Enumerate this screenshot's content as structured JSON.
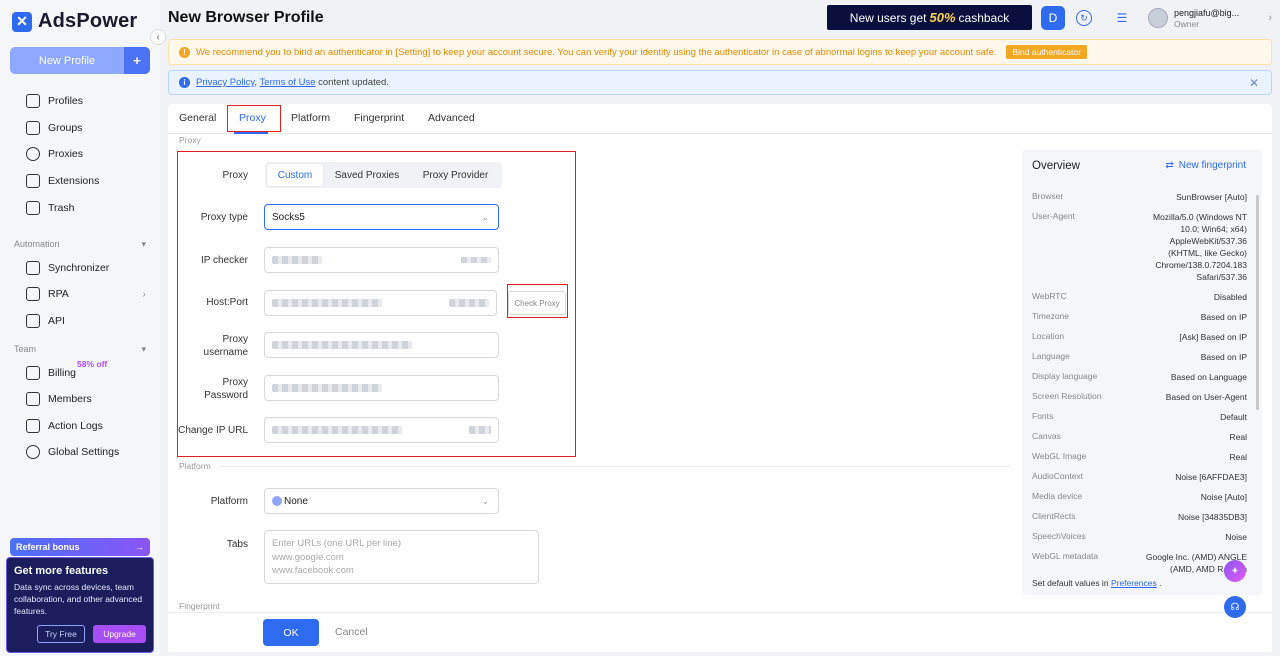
{
  "app": {
    "name": "AdsPower",
    "logo_glyph": "✕"
  },
  "sidebar": {
    "new_profile_label": "New Profile",
    "new_profile_icon": "+",
    "collapse_icon": "‹",
    "items": [
      {
        "label": "Profiles",
        "icon": "profiles-icon"
      },
      {
        "label": "Groups",
        "icon": "groups-icon"
      },
      {
        "label": "Proxies",
        "icon": "proxies-icon"
      },
      {
        "label": "Extensions",
        "icon": "extensions-icon"
      },
      {
        "label": "Trash",
        "icon": "trash-icon"
      }
    ],
    "automation_label": "Automation",
    "automation_items": [
      {
        "label": "Synchronizer",
        "icon": "synchronizer-icon"
      },
      {
        "label": "RPA",
        "icon": "rpa-icon"
      },
      {
        "label": "API",
        "icon": "api-icon"
      }
    ],
    "team_label": "Team",
    "team_items": [
      {
        "label": "Billing",
        "icon": "billing-icon"
      },
      {
        "label": "Members",
        "icon": "members-icon"
      },
      {
        "label": "Action Logs",
        "icon": "action-logs-icon"
      },
      {
        "label": "Global Settings",
        "icon": "global-settings-icon"
      }
    ],
    "billing_badge": "58% off",
    "referral_label": "Referral bonus",
    "referral_arrow": "→",
    "promo": {
      "title": "Get more features",
      "text": "Data sync across devices, team collaboration, and other advanced features.",
      "try_label": "Try Free",
      "upgrade_label": "Upgrade"
    }
  },
  "header": {
    "title": "New Browser Profile",
    "banner_pre": "New users get",
    "banner_percent": "50%",
    "banner_post": "cashback",
    "user_name": "pengjiafu@big...",
    "user_role": "Owner"
  },
  "notices": {
    "warning": "We recommend you to bind an authenticator in [Setting] to keep your account secure. You can verify your identity using the authenticator in case of abnormal logins to keep your account safe.",
    "bind_label": "Bind authenticator",
    "info_link1": "Privacy Policy",
    "info_sep": ",",
    "info_link2": "Terms of Use",
    "info_tail": "content updated.",
    "close_icon": "✕"
  },
  "tabs": [
    "General",
    "Proxy",
    "Platform",
    "Fingerprint",
    "Advanced"
  ],
  "form": {
    "section_proxy": "Proxy",
    "proxy_label": "Proxy",
    "proxy_modes": [
      "Custom",
      "Saved Proxies",
      "Proxy Provider"
    ],
    "proxy_type_label": "Proxy type",
    "proxy_type_value": "Socks5",
    "ip_checker_label": "IP checker",
    "host_port_label": "Host:Port",
    "check_proxy_label": "Check Proxy",
    "username_label_1": "Proxy",
    "username_label_2": "username",
    "password_label_1": "Proxy",
    "password_label_2": "Password",
    "change_ip_label": "Change IP URL",
    "section_platform": "Platform",
    "platform_label": "Platform",
    "platform_value": "None",
    "tabs_label": "Tabs",
    "tabs_placeholder_1": "Enter URLs (one URL per line)",
    "tabs_placeholder_2": "www.google.com",
    "tabs_placeholder_3": "www.facebook.com",
    "section_fingerprint": "Fingerprint",
    "ok_label": "OK",
    "cancel_label": "Cancel"
  },
  "overview": {
    "title": "Overview",
    "new_fingerprint": "New fingerprint",
    "rows": [
      {
        "key": "Browser",
        "value": "SunBrowser [Auto]"
      },
      {
        "key": "User-Agent",
        "value": "Mozilla/5.0 (Windows NT 10.0; Win64; x64) AppleWebKit/537.36 (KHTML, like Gecko) Chrome/138.0.7204.183 Safari/537.36"
      },
      {
        "key": "WebRTC",
        "value": "Disabled"
      },
      {
        "key": "Timezone",
        "value": "Based on IP"
      },
      {
        "key": "Location",
        "value": "[Ask] Based on IP"
      },
      {
        "key": "Language",
        "value": "Based on IP"
      },
      {
        "key": "Display language",
        "value": "Based on Language"
      },
      {
        "key": "Screen Resolution",
        "value": "Based on User-Agent"
      },
      {
        "key": "Fonts",
        "value": "Default"
      },
      {
        "key": "Canvas",
        "value": "Real"
      },
      {
        "key": "WebGL Image",
        "value": "Real"
      },
      {
        "key": "AudioContext",
        "value": "Noise [6AFFDAE3]"
      },
      {
        "key": "Media device",
        "value": "Noise [Auto]"
      },
      {
        "key": "ClientRects",
        "value": "Noise [34835DB3]"
      },
      {
        "key": "SpeechVoices",
        "value": "Noise"
      },
      {
        "key": "WebGL metadata",
        "value": "Google Inc. (AMD) ANGLE (AMD, AMD Radeon"
      }
    ],
    "footer_pre": "Set default values in",
    "footer_link": "Preferences",
    "footer_post": "."
  },
  "colors": {
    "accent": "#2e6bf0",
    "warning": "#f5a623",
    "highlight": "#e02020"
  }
}
